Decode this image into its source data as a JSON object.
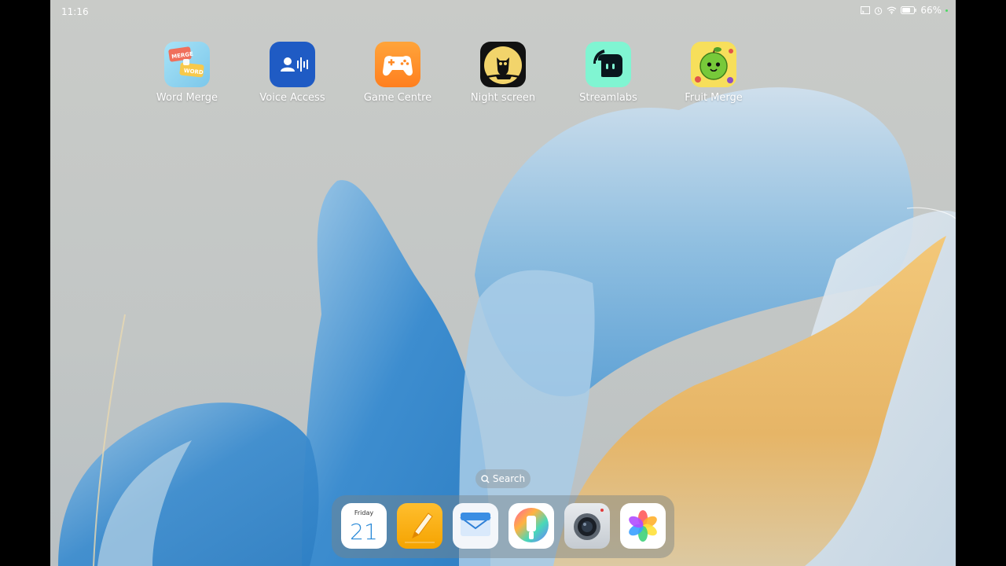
{
  "status": {
    "time": "11:16",
    "battery": "66%"
  },
  "apps": [
    {
      "label": "Word Merge",
      "icon": "word-merge-icon"
    },
    {
      "label": "Voice Access",
      "icon": "voice-access-icon"
    },
    {
      "label": "Game Centre",
      "icon": "gamepad-icon"
    },
    {
      "label": "Night screen",
      "icon": "owl-icon"
    },
    {
      "label": "Streamlabs",
      "icon": "streamlabs-icon"
    },
    {
      "label": "Fruit Merge",
      "icon": "melon-icon"
    }
  ],
  "search": {
    "label": "Search"
  },
  "dock": {
    "calendar": {
      "day": "Friday",
      "date": "21"
    },
    "apps": [
      "calendar-icon",
      "notes-icon",
      "email-icon",
      "themes-icon",
      "camera-icon",
      "gallery-icon"
    ]
  },
  "colors": {
    "text_on_wallpaper": "#ffffff",
    "petal_blue": "#3f8fcf",
    "petal_gold": "#e3b25b"
  }
}
